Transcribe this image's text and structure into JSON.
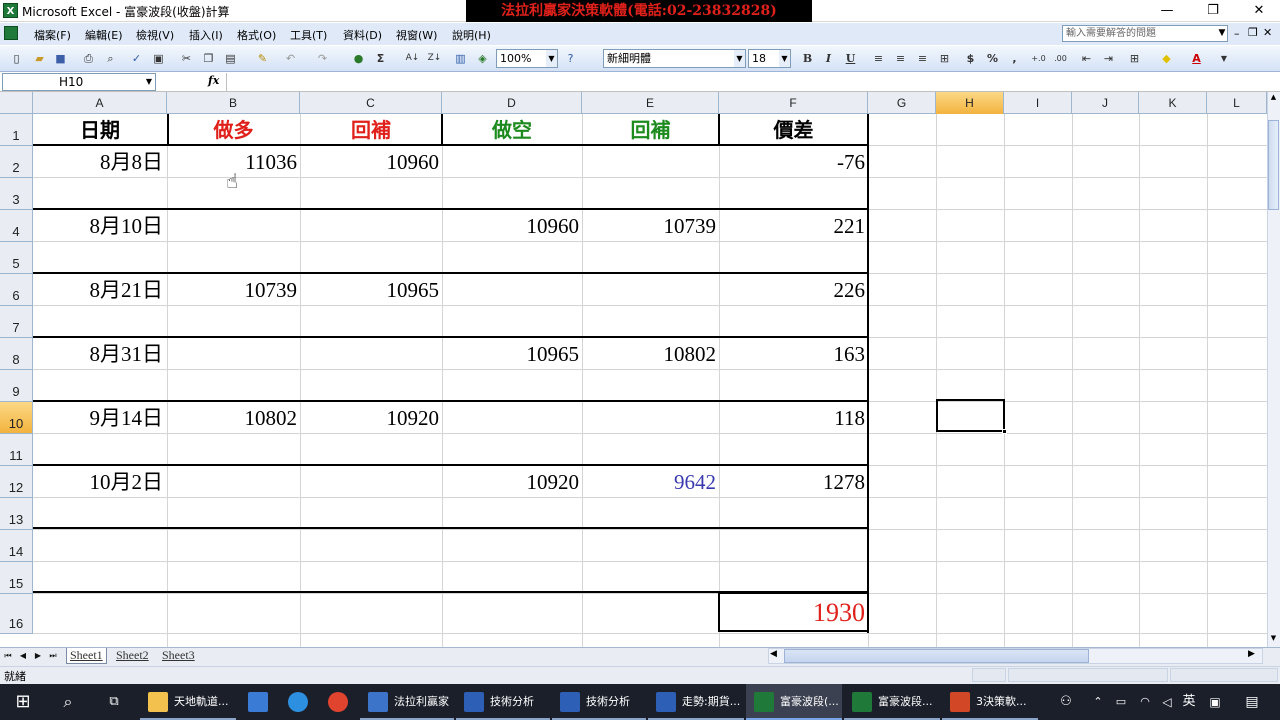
{
  "window": {
    "title": "Microsoft Excel - 富豪波段(收盤)計算",
    "banner": "法拉利贏家決策軟體(電話:02-23832828)",
    "min": "—",
    "restore": "❐",
    "close": "✕"
  },
  "menu": [
    "檔案(F)",
    "編輯(E)",
    "檢視(V)",
    "插入(I)",
    "格式(O)",
    "工具(T)",
    "資料(D)",
    "視窗(W)",
    "說明(H)"
  ],
  "help_box": {
    "placeholder": "輸入需要解答的問題"
  },
  "toolbar": {
    "zoom": "100%",
    "font": "新細明體",
    "font_size": "18",
    "bold": "B",
    "italic": "I",
    "underline": "U",
    "currency": "$",
    "percent": "%",
    "comma": ","
  },
  "formula_bar": {
    "name_box": "H10",
    "fx": "fx",
    "value": ""
  },
  "columns": [
    "A",
    "B",
    "C",
    "D",
    "E",
    "F",
    "G",
    "H",
    "I",
    "J",
    "K",
    "L"
  ],
  "rows": [
    "1",
    "2",
    "3",
    "4",
    "5",
    "6",
    "7",
    "8",
    "9",
    "10",
    "11",
    "12",
    "13",
    "14",
    "15",
    "16"
  ],
  "selected_cell": {
    "col": "H",
    "row": "10"
  },
  "sheet": {
    "headers": {
      "date": "日期",
      "long": "做多",
      "long_cover": "回補",
      "short": "做空",
      "short_cover": "回補",
      "diff": "價差"
    },
    "rows": [
      {
        "date": "8月8日",
        "long": "11036",
        "long_cover": "10960",
        "short": "",
        "short_cover": "",
        "diff": "-76"
      },
      {
        "date": "8月10日",
        "long": "",
        "long_cover": "",
        "short": "10960",
        "short_cover": "10739",
        "diff": "221"
      },
      {
        "date": "8月21日",
        "long": "10739",
        "long_cover": "10965",
        "short": "",
        "short_cover": "",
        "diff": "226"
      },
      {
        "date": "8月31日",
        "long": "",
        "long_cover": "",
        "short": "10965",
        "short_cover": "10802",
        "diff": "163"
      },
      {
        "date": "9月14日",
        "long": "10802",
        "long_cover": "10920",
        "short": "",
        "short_cover": "",
        "diff": "118"
      },
      {
        "date": "10月2日",
        "long": "",
        "long_cover": "",
        "short": "10920",
        "short_cover": "9642",
        "diff": "1278"
      }
    ],
    "total": "1930"
  },
  "colors": {
    "long_header": "#e0201a",
    "short_header": "#1c8a1c",
    "total": "#e0201a",
    "highlight_value": "#3a3ab0",
    "selection_header": "#f3b33e"
  },
  "sheet_tabs": [
    "Sheet1",
    "Sheet2",
    "Sheet3"
  ],
  "status": {
    "text": "就緒"
  },
  "taskbar": {
    "items": [
      "天地軌道...",
      "法拉利贏家",
      "技術分析",
      "技術分析",
      "走勢:期貨...",
      "富豪波段(...",
      "富豪波段...",
      "3決策軟..."
    ],
    "ime": "英"
  }
}
